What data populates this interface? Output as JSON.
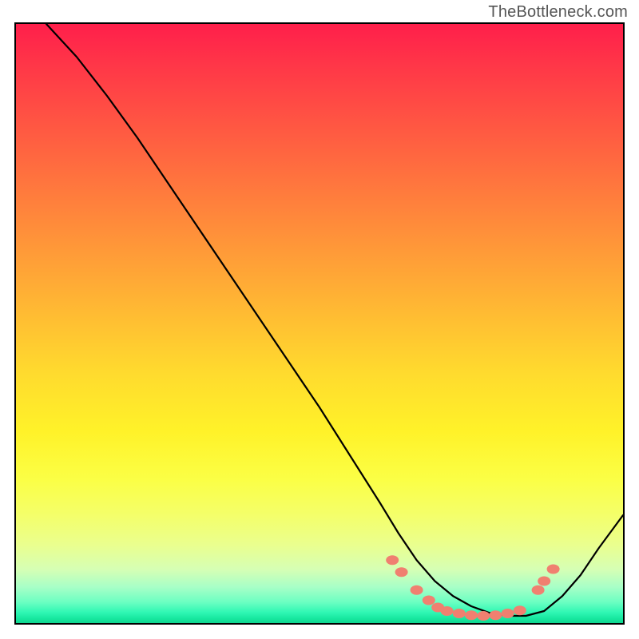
{
  "attribution": "TheBottleneck.com",
  "chart_data": {
    "type": "line",
    "title": "",
    "xlabel": "",
    "ylabel": "",
    "xlim": [
      0,
      100
    ],
    "ylim": [
      0,
      100
    ],
    "x": [
      5,
      10,
      15,
      20,
      25,
      30,
      35,
      40,
      45,
      50,
      55,
      60,
      63,
      66,
      69,
      72,
      75,
      78,
      81,
      84,
      87,
      90,
      93,
      96,
      100
    ],
    "values": [
      100,
      94.5,
      88,
      81,
      73.5,
      66,
      58.5,
      51,
      43.5,
      36,
      28,
      20,
      15,
      10.5,
      7,
      4.5,
      2.8,
      1.7,
      1.2,
      1.2,
      2,
      4.5,
      8,
      12.5,
      18
    ],
    "series": [
      {
        "name": "curve",
        "x": [
          5,
          10,
          15,
          20,
          25,
          30,
          35,
          40,
          45,
          50,
          55,
          60,
          63,
          66,
          69,
          72,
          75,
          78,
          81,
          84,
          87,
          90,
          93,
          96,
          100
        ],
        "y": [
          100,
          94.5,
          88,
          81,
          73.5,
          66,
          58.5,
          51,
          43.5,
          36,
          28,
          20,
          15,
          10.5,
          7,
          4.5,
          2.8,
          1.7,
          1.2,
          1.2,
          2,
          4.5,
          8,
          12.5,
          18
        ]
      }
    ],
    "markers": [
      {
        "x": 62,
        "y": 10.5
      },
      {
        "x": 63.5,
        "y": 8.5
      },
      {
        "x": 66,
        "y": 5.5
      },
      {
        "x": 68,
        "y": 3.8
      },
      {
        "x": 69.5,
        "y": 2.6
      },
      {
        "x": 71,
        "y": 2.0
      },
      {
        "x": 73,
        "y": 1.6
      },
      {
        "x": 75,
        "y": 1.3
      },
      {
        "x": 77,
        "y": 1.2
      },
      {
        "x": 79,
        "y": 1.3
      },
      {
        "x": 81,
        "y": 1.6
      },
      {
        "x": 83,
        "y": 2.1
      },
      {
        "x": 86,
        "y": 5.5
      },
      {
        "x": 87,
        "y": 7.0
      },
      {
        "x": 88.5,
        "y": 9.0
      }
    ],
    "marker_color": "#f08070",
    "curve_color": "#000000"
  }
}
